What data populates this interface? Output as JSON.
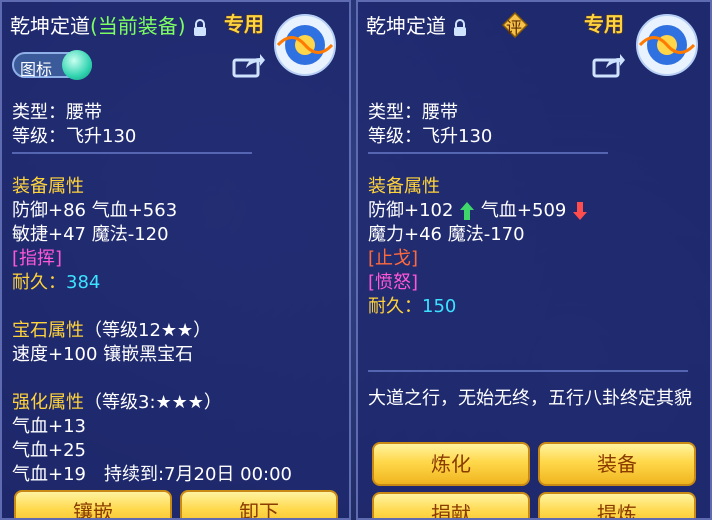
{
  "left": {
    "title": "乾坤定道",
    "title_tag": "(当前装备)",
    "exclusive": "专用",
    "toggle_label": "图标",
    "type": "类型：腰带",
    "level": "等级：飞升130",
    "equip_header": "装备属性",
    "attr1": "防御+86 气血+563",
    "attr2": "敏捷+47 魔法-120",
    "special": "[指挥]",
    "durability_label": "耐久：",
    "durability_value": "384",
    "gem_header": "宝石属性",
    "gem_detail": "（等级12★★）",
    "gem_line": "速度+100 镶嵌黑宝石",
    "enhance_header": "强化属性",
    "enhance_detail": "（等级3:★★★）",
    "enhance1": "气血+13",
    "enhance2": "气血+25",
    "enhance3": "气血+19　持续到:7月20日 00:00",
    "buttons": [
      "镶嵌",
      "卸下"
    ]
  },
  "right": {
    "title": "乾坤定道",
    "exclusive": "专用",
    "rate": "评",
    "type": "类型：腰带",
    "level": "等级：飞升130",
    "equip_header": "装备属性",
    "attr1a": "防御+102",
    "attr1b": "气血+509",
    "attr2": "魔力+46 魔法-170",
    "special1": "[止戈]",
    "special2": "[愤怒]",
    "durability_label": "耐久：",
    "durability_value": "150",
    "description": "大道之行，无始无终，五行八卦终定其貌",
    "buttons": [
      "炼化",
      "装备",
      "捐献",
      "提炼"
    ]
  },
  "colors": {
    "title": "#ffffff",
    "tag": "#7dff63",
    "header": "#ffd33b",
    "special": "#ff57d8",
    "durability": "#3ce2ff",
    "up": "#3fd66b",
    "down": "#ff4d4d"
  },
  "icons": [
    "lock-icon",
    "share-icon",
    "emblem-icon",
    "rate-icon",
    "arrow-up-icon",
    "arrow-down-icon"
  ]
}
